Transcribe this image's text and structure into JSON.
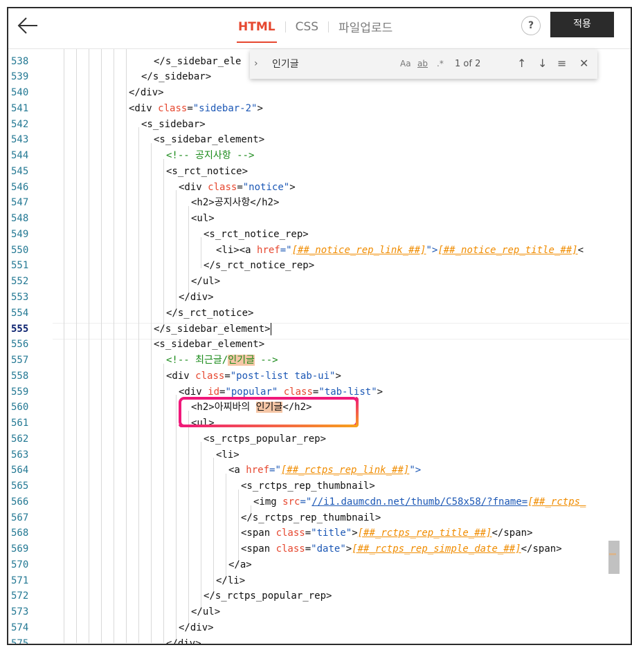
{
  "topbar": {
    "tabs": [
      {
        "label": "HTML",
        "active": true
      },
      {
        "label": "CSS",
        "active": false
      },
      {
        "label": "파일업로드",
        "active": false
      }
    ],
    "help_label": "?",
    "apply_label": "적용"
  },
  "find": {
    "query": "인기글",
    "match_case": "Aa",
    "whole_word": "ab",
    "regex": ".*",
    "count": "1 of 2"
  },
  "editor": {
    "current_line": "555",
    "lines": [
      {
        "n": "538"
      },
      {
        "n": "539"
      },
      {
        "n": "540"
      },
      {
        "n": "541"
      },
      {
        "n": "542"
      },
      {
        "n": "543"
      },
      {
        "n": "544"
      },
      {
        "n": "545"
      },
      {
        "n": "546"
      },
      {
        "n": "547"
      },
      {
        "n": "548"
      },
      {
        "n": "549"
      },
      {
        "n": "550"
      },
      {
        "n": "551"
      },
      {
        "n": "552"
      },
      {
        "n": "553"
      },
      {
        "n": "554"
      },
      {
        "n": "555"
      },
      {
        "n": "556"
      },
      {
        "n": "557"
      },
      {
        "n": "558"
      },
      {
        "n": "559"
      },
      {
        "n": "560"
      },
      {
        "n": "561"
      },
      {
        "n": "562"
      },
      {
        "n": "563"
      },
      {
        "n": "564"
      },
      {
        "n": "565"
      },
      {
        "n": "566"
      },
      {
        "n": "567"
      },
      {
        "n": "568"
      },
      {
        "n": "569"
      },
      {
        "n": "570"
      },
      {
        "n": "571"
      },
      {
        "n": "572"
      },
      {
        "n": "573"
      },
      {
        "n": "574"
      },
      {
        "n": "575"
      }
    ],
    "code": {
      "l538": "</s_sidebar_ele",
      "l539": "</s_sidebar>",
      "l540": "</div>",
      "l541_tag": "<div ",
      "l541_attr": "class",
      "l541_eq": "=",
      "l541_str": "\"sidebar-2\"",
      "l541_end": ">",
      "l542": "<s_sidebar>",
      "l543": "<s_sidebar_element>",
      "l544": "<!-- 공지사항 -->",
      "l545": "<s_rct_notice>",
      "l546_tag": "<div ",
      "l546_attr": "class",
      "l546_eq": "=",
      "l546_str": "\"notice\"",
      "l546_end": ">",
      "l547": "<h2>공지사항</h2>",
      "l548": "<ul>",
      "l549": "<s_rct_notice_rep>",
      "l550_a": "<li><a ",
      "l550_attr": "href",
      "l550_eq": "=\"",
      "l550_tpl1": "[##_notice_rep_link_##]",
      "l550_mid": "\">",
      "l550_tpl2": "[##_notice_rep_title_##]",
      "l550_end": "<",
      "l551": "</s_rct_notice_rep>",
      "l552": "</ul>",
      "l553": "</div>",
      "l554": "</s_rct_notice>",
      "l555": "</s_sidebar_element>",
      "l556": "<s_sidebar_element>",
      "l557_a": "<!-- 최근글/",
      "l557_hl": "인기글",
      "l557_b": " -->",
      "l558_tag": "<div ",
      "l558_attr": "class",
      "l558_eq": "=",
      "l558_str": "\"post-list tab-ui\"",
      "l558_end": ">",
      "l559_tag": "<div ",
      "l559_attr1": "id",
      "l559_eq1": "=",
      "l559_str1": "\"popular\"",
      "l559_sp": " ",
      "l559_attr2": "class",
      "l559_eq2": "=",
      "l559_str2": "\"tab-list\"",
      "l559_end": ">",
      "l560_a": "<h2>아찌바의 ",
      "l560_hl": "인기글",
      "l560_b": "</h2>",
      "l561": "<ul>",
      "l562": "<s_rctps_popular_rep>",
      "l563": "<li>",
      "l564_tag": "<a ",
      "l564_attr": "href",
      "l564_eq": "=\"",
      "l564_tpl": "[##_rctps_rep_link_##]",
      "l564_end": "\">",
      "l565": "<s_rctps_rep_thumbnail>",
      "l566_tag": "<img ",
      "l566_attr": "src",
      "l566_eq": "=\"",
      "l566_str": "//i1.daumcdn.net/thumb/C58x58/?fname=",
      "l566_tpl": "[##_rctps_",
      "l567": "</s_rctps_rep_thumbnail>",
      "l568_tag": "<span ",
      "l568_attr": "class",
      "l568_eq": "=",
      "l568_str": "\"title\"",
      "l568_gt": ">",
      "l568_tpl": "[##_rctps_rep_title_##]",
      "l568_end": "</span>",
      "l569_tag": "<span ",
      "l569_attr": "class",
      "l569_eq": "=",
      "l569_str": "\"date\"",
      "l569_gt": ">",
      "l569_tpl": "[##_rctps_rep_simple_date_##]",
      "l569_end": "</span>",
      "l570": "</a>",
      "l571": "</li>",
      "l572": "</s_rctps_popular_rep>",
      "l573": "</ul>",
      "l574": "</div>",
      "l575": "</div>"
    }
  }
}
